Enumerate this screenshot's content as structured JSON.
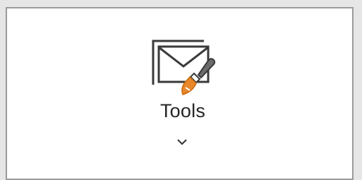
{
  "ribbon": {
    "tools_button": {
      "label": "Tools",
      "icon": "mail-clean-icon",
      "dropdown_icon": "chevron-down-icon"
    }
  },
  "colors": {
    "icon_stroke": "#3a3a3a",
    "brush_orange": "#e8872a",
    "brush_gray": "#6b6b6b",
    "label_text": "#262626",
    "panel_border": "#9a9a9a"
  }
}
